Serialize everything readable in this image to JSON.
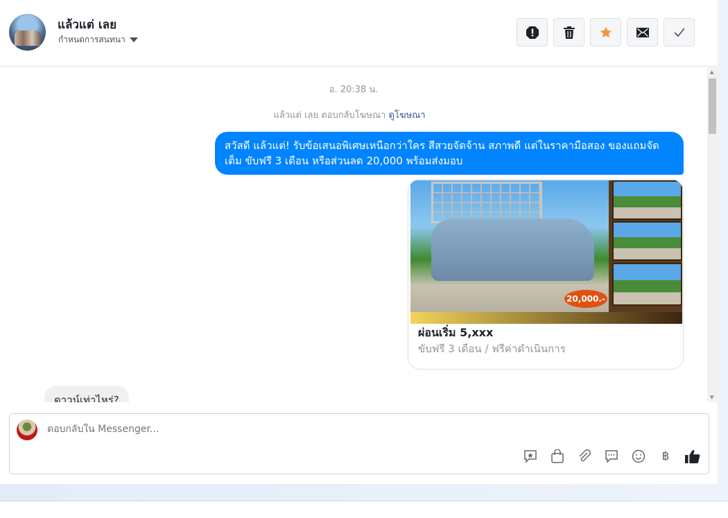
{
  "header": {
    "contact_name": "แล้วแต่ เลย",
    "settings_label": "กำหนดการสนทนา",
    "actions": [
      {
        "name": "report",
        "icon": "exclamation-icon"
      },
      {
        "name": "delete",
        "icon": "trash-icon"
      },
      {
        "name": "star",
        "icon": "star-icon",
        "color": "#f7923a"
      },
      {
        "name": "mark-unread",
        "icon": "envelope-icon"
      },
      {
        "name": "done",
        "icon": "check-icon"
      }
    ]
  },
  "chat": {
    "timestamp": "อ. 20:38 น.",
    "system_text": "แล้วแต่ เลย ตอบกลับโฆษณา",
    "system_link": "ดูโฆษณา",
    "outgoing_message": "สวัสดี แล้วแต่! รับข้อเสนอพิเศษเหนือกว่าใคร สีสวยจัดจ้าน สภาพดี แต่ในราคามือสอง ของแถมจัดเต็ม ขับฟรี 3 เดือน หรือส่วนลด 20,000 พร้อมส่งมอบ",
    "ad_card": {
      "image_badge": "20,000.-",
      "title": "ผ่อนเริ่ม 5,xxx",
      "subtitle": "ขับฟรี 3 เดือน / ฟรีค่าดำเนินการ"
    },
    "incoming_message": "ดาวน์เท่าไหร่?"
  },
  "composer": {
    "placeholder": "ตอบกลับใน Messenger...",
    "tools": [
      "saved-reply-icon",
      "shop-bag-icon",
      "paperclip-icon",
      "chat-bubble-icon",
      "emoji-icon",
      "baht-icon",
      "thumbs-up-icon"
    ],
    "baht_symbol": "฿"
  },
  "colors": {
    "accent": "#0084ff",
    "star": "#f7923a"
  }
}
